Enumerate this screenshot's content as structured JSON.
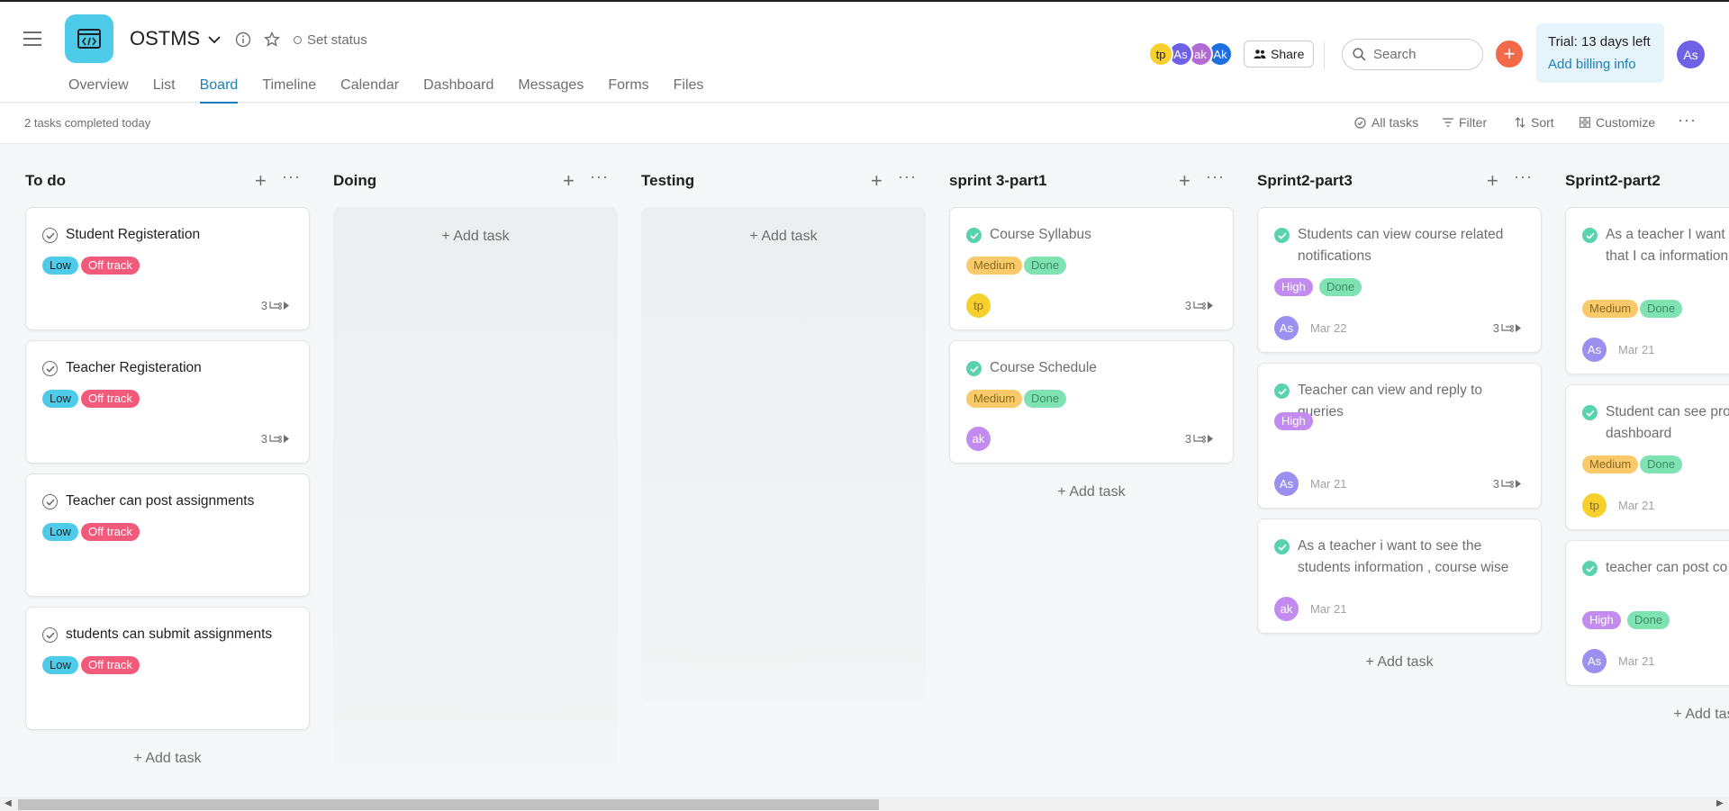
{
  "header": {
    "project_title": "OSTMS",
    "set_status": "Set status",
    "tabs": [
      {
        "label": "Overview",
        "active": false
      },
      {
        "label": "List",
        "active": false
      },
      {
        "label": "Board",
        "active": true
      },
      {
        "label": "Timeline",
        "active": false
      },
      {
        "label": "Calendar",
        "active": false
      },
      {
        "label": "Dashboard",
        "active": false
      },
      {
        "label": "Messages",
        "active": false
      },
      {
        "label": "Forms",
        "active": false
      },
      {
        "label": "Files",
        "active": false
      }
    ],
    "members": [
      {
        "initials": "tp",
        "color": "#f8d02c",
        "text_color": "#1e1f21"
      },
      {
        "initials": "As",
        "color": "#6f61e6",
        "text_color": "#ffffff"
      },
      {
        "initials": "ak",
        "color": "#b36bd4",
        "text_color": "#ffffff"
      },
      {
        "initials": "Ak",
        "color": "#1f6fe0",
        "text_color": "#ffffff"
      }
    ],
    "share_label": "Share",
    "search_placeholder": "Search",
    "trial_text": "Trial: 13 days left",
    "billing_link": "Add billing info",
    "user_avatar": "As"
  },
  "subbar": {
    "completed_text": "2 tasks completed today",
    "all_tasks": "All tasks",
    "filter": "Filter",
    "sort": "Sort",
    "customize": "Customize"
  },
  "board": {
    "add_task": "+ Add task",
    "columns": [
      {
        "title": "To do",
        "cards": [
          {
            "title": "Student Registeration",
            "done": false,
            "tags": [
              "Low",
              "Off track"
            ],
            "subtasks": "3",
            "avatar": "",
            "date": ""
          },
          {
            "title": "Teacher Registeration",
            "done": false,
            "tags": [
              "Low",
              "Off track"
            ],
            "subtasks": "3",
            "avatar": "",
            "date": ""
          },
          {
            "title": "Teacher can post assignments",
            "done": false,
            "tags": [
              "Low",
              "Off track"
            ],
            "subtasks": "",
            "avatar": "",
            "date": ""
          },
          {
            "title": "students can submit assignments",
            "done": false,
            "tags": [
              "Low",
              "Off track"
            ],
            "subtasks": "",
            "avatar": "",
            "date": ""
          }
        ]
      },
      {
        "title": "Doing",
        "cards": []
      },
      {
        "title": "Testing",
        "cards": []
      },
      {
        "title": "sprint 3-part1",
        "cards": [
          {
            "title": "Course Syllabus",
            "done": true,
            "tags": [
              "Medium",
              "Done"
            ],
            "subtasks": "3",
            "avatar": "tp",
            "date": ""
          },
          {
            "title": "Course Schedule",
            "done": true,
            "tags": [
              "Medium",
              "Done"
            ],
            "subtasks": "3",
            "avatar": "ak",
            "date": ""
          }
        ]
      },
      {
        "title": "Sprint2-part3",
        "cards": [
          {
            "title": "Students can view course related notifications",
            "done": true,
            "tags": [
              "High",
              "Done"
            ],
            "subtasks": "3",
            "avatar": "As",
            "date": "Mar 22"
          },
          {
            "title": "Teacher can view and reply to queries",
            "done": true,
            "tags": [
              "High"
            ],
            "subtasks": "3",
            "avatar": "As",
            "date": "Mar 21"
          },
          {
            "title": "As a teacher i want to see the students information , course wise",
            "done": true,
            "tags": [],
            "subtasks": "",
            "avatar": "ak",
            "date": "Mar 21"
          }
        ]
      },
      {
        "title": "Sprint2-part2",
        "cards": [
          {
            "title": "As a teacher I want and subjects so that I ca information related to t",
            "done": true,
            "tags": [
              "Medium",
              "Done"
            ],
            "subtasks": "",
            "avatar": "As",
            "date": "Mar 21"
          },
          {
            "title": "Student can see pro details from dashboard",
            "done": true,
            "tags": [
              "Medium",
              "Done"
            ],
            "subtasks": "",
            "avatar": "tp",
            "date": "Mar 21"
          },
          {
            "title": "teacher can post co notifications",
            "done": true,
            "tags": [
              "High",
              "Done"
            ],
            "subtasks": "",
            "avatar": "As",
            "date": "Mar 21"
          }
        ]
      }
    ]
  },
  "colors": {
    "Low": {
      "bg": "#4ecbe8",
      "fg": "#1e1f21"
    },
    "Off track": {
      "bg": "#f25a7b",
      "fg": "#ffffff"
    },
    "Medium": {
      "bg": "#f9c96a",
      "fg": "#8a6a20"
    },
    "Done": {
      "bg": "#7ee2b3",
      "fg": "#3d8c66"
    },
    "High": {
      "bg": "#c38af0",
      "fg": "#ffffff"
    },
    "accent": "#1a7fb8"
  },
  "avatar_colors": {
    "tp": {
      "bg": "#f8d02c",
      "fg": "#8a6a20"
    },
    "As": {
      "bg": "#9b8ff0",
      "fg": "#ffffff"
    },
    "ak": {
      "bg": "#c38af0",
      "fg": "#ffffff"
    }
  }
}
